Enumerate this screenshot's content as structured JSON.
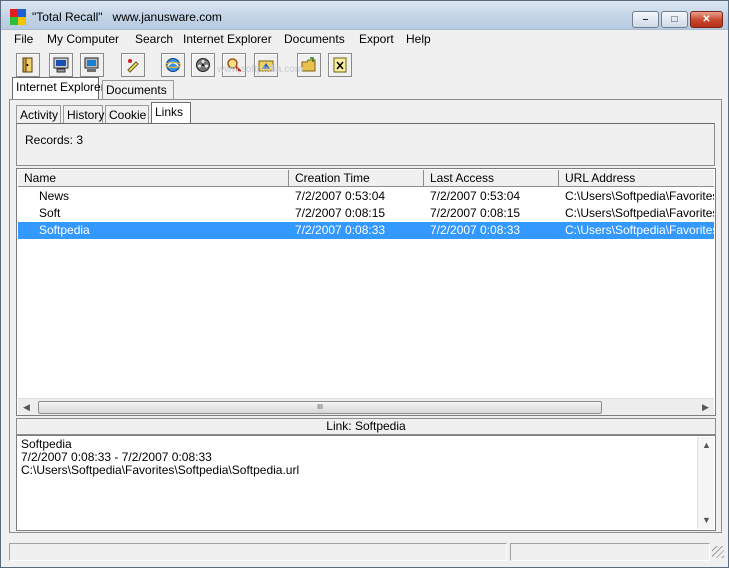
{
  "window": {
    "title": "\"Total Recall\"   www.janusware.com",
    "minimize_icon": "minimize-icon",
    "maximize_icon": "maximize-icon",
    "close_icon": "close-icon"
  },
  "menu": [
    "File",
    "My Computer",
    "Search",
    "Internet Explorer",
    "Documents",
    "Export",
    "Help"
  ],
  "toolbar": {
    "icons": [
      "exit-door-icon",
      "computer-icon",
      "network-computer-icon",
      "pen-icon",
      "ie-globe-icon",
      "film-reel-icon",
      "search-magnifier-icon",
      "camera-folder-icon",
      "folder-open-icon",
      "excel-export-icon"
    ]
  },
  "watermark": "www.softpedia.com",
  "main_tabs": [
    "Internet Explorer",
    "Documents"
  ],
  "sub_tabs": [
    "Activity",
    "History",
    "Cookie",
    "Links"
  ],
  "active_sub_tab": "Links",
  "records": "Records: 3",
  "table": {
    "columns": [
      "Name",
      "Creation Time",
      "Last Access",
      "URL Address"
    ],
    "rows": [
      {
        "name": "News",
        "created": "7/2/2007 0:53:04",
        "accessed": "7/2/2007 0:53:04",
        "url": "C:\\Users\\Softpedia\\Favorites\\News.url"
      },
      {
        "name": "Soft",
        "created": "7/2/2007 0:08:15",
        "accessed": "7/2/2007 0:08:15",
        "url": "C:\\Users\\Softpedia\\Favorites\\Soft.url"
      },
      {
        "name": "Softpedia",
        "created": "7/2/2007 0:08:33",
        "accessed": "7/2/2007 0:08:33",
        "url": "C:\\Users\\Softpedia\\Favorites\\Softpedia.url"
      }
    ],
    "selected_row": 2,
    "scroll_grip": "III"
  },
  "link_label": "Link: Softpedia",
  "detail": {
    "lines": [
      "Softpedia",
      "7/2/2007 0:08:33 - 7/2/2007 0:08:33",
      "C:\\Users\\Softpedia\\Favorites\\Softpedia\\Softpedia.url"
    ]
  },
  "colors": {
    "selection": "#3399ff",
    "title_gradient_top": "#dbe6f2",
    "close_button": "#c7452d"
  }
}
